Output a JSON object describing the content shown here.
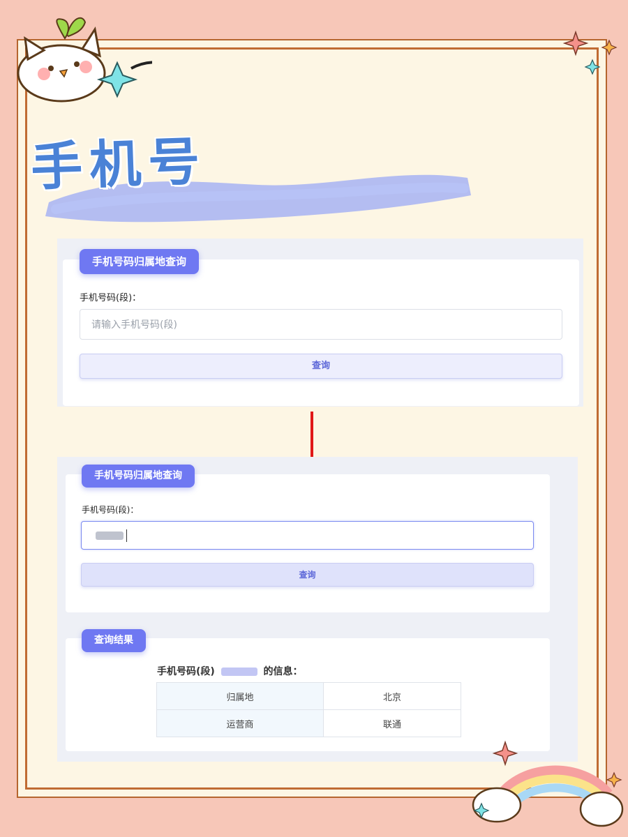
{
  "poster": {
    "title": "手机号",
    "colors": {
      "background": "#f7c7b8",
      "paper": "#fdf6e4",
      "frame": "#c06b33",
      "title": "#4a82d6",
      "accent": "#6f78f2"
    }
  },
  "query_form_1": {
    "badge": "手机号码归属地查询",
    "field_label": "手机号码(段)：",
    "input_placeholder": "请输入手机号码(段)",
    "button_label": "查询"
  },
  "query_form_2": {
    "badge": "手机号码归属地查询",
    "field_label": "手机号码(段)：",
    "input_value": "",
    "button_label": "查询"
  },
  "result": {
    "badge": "查询结果",
    "heading_prefix": "手机号码(段)",
    "heading_suffix": "的信息：",
    "rows": [
      {
        "key": "归属地",
        "value": "北京"
      },
      {
        "key": "运营商",
        "value": "联通"
      }
    ]
  },
  "icons": [
    "cat-sticker-icon",
    "sparkle-icon",
    "rainbow-cloud-icon",
    "down-arrow-icon"
  ]
}
